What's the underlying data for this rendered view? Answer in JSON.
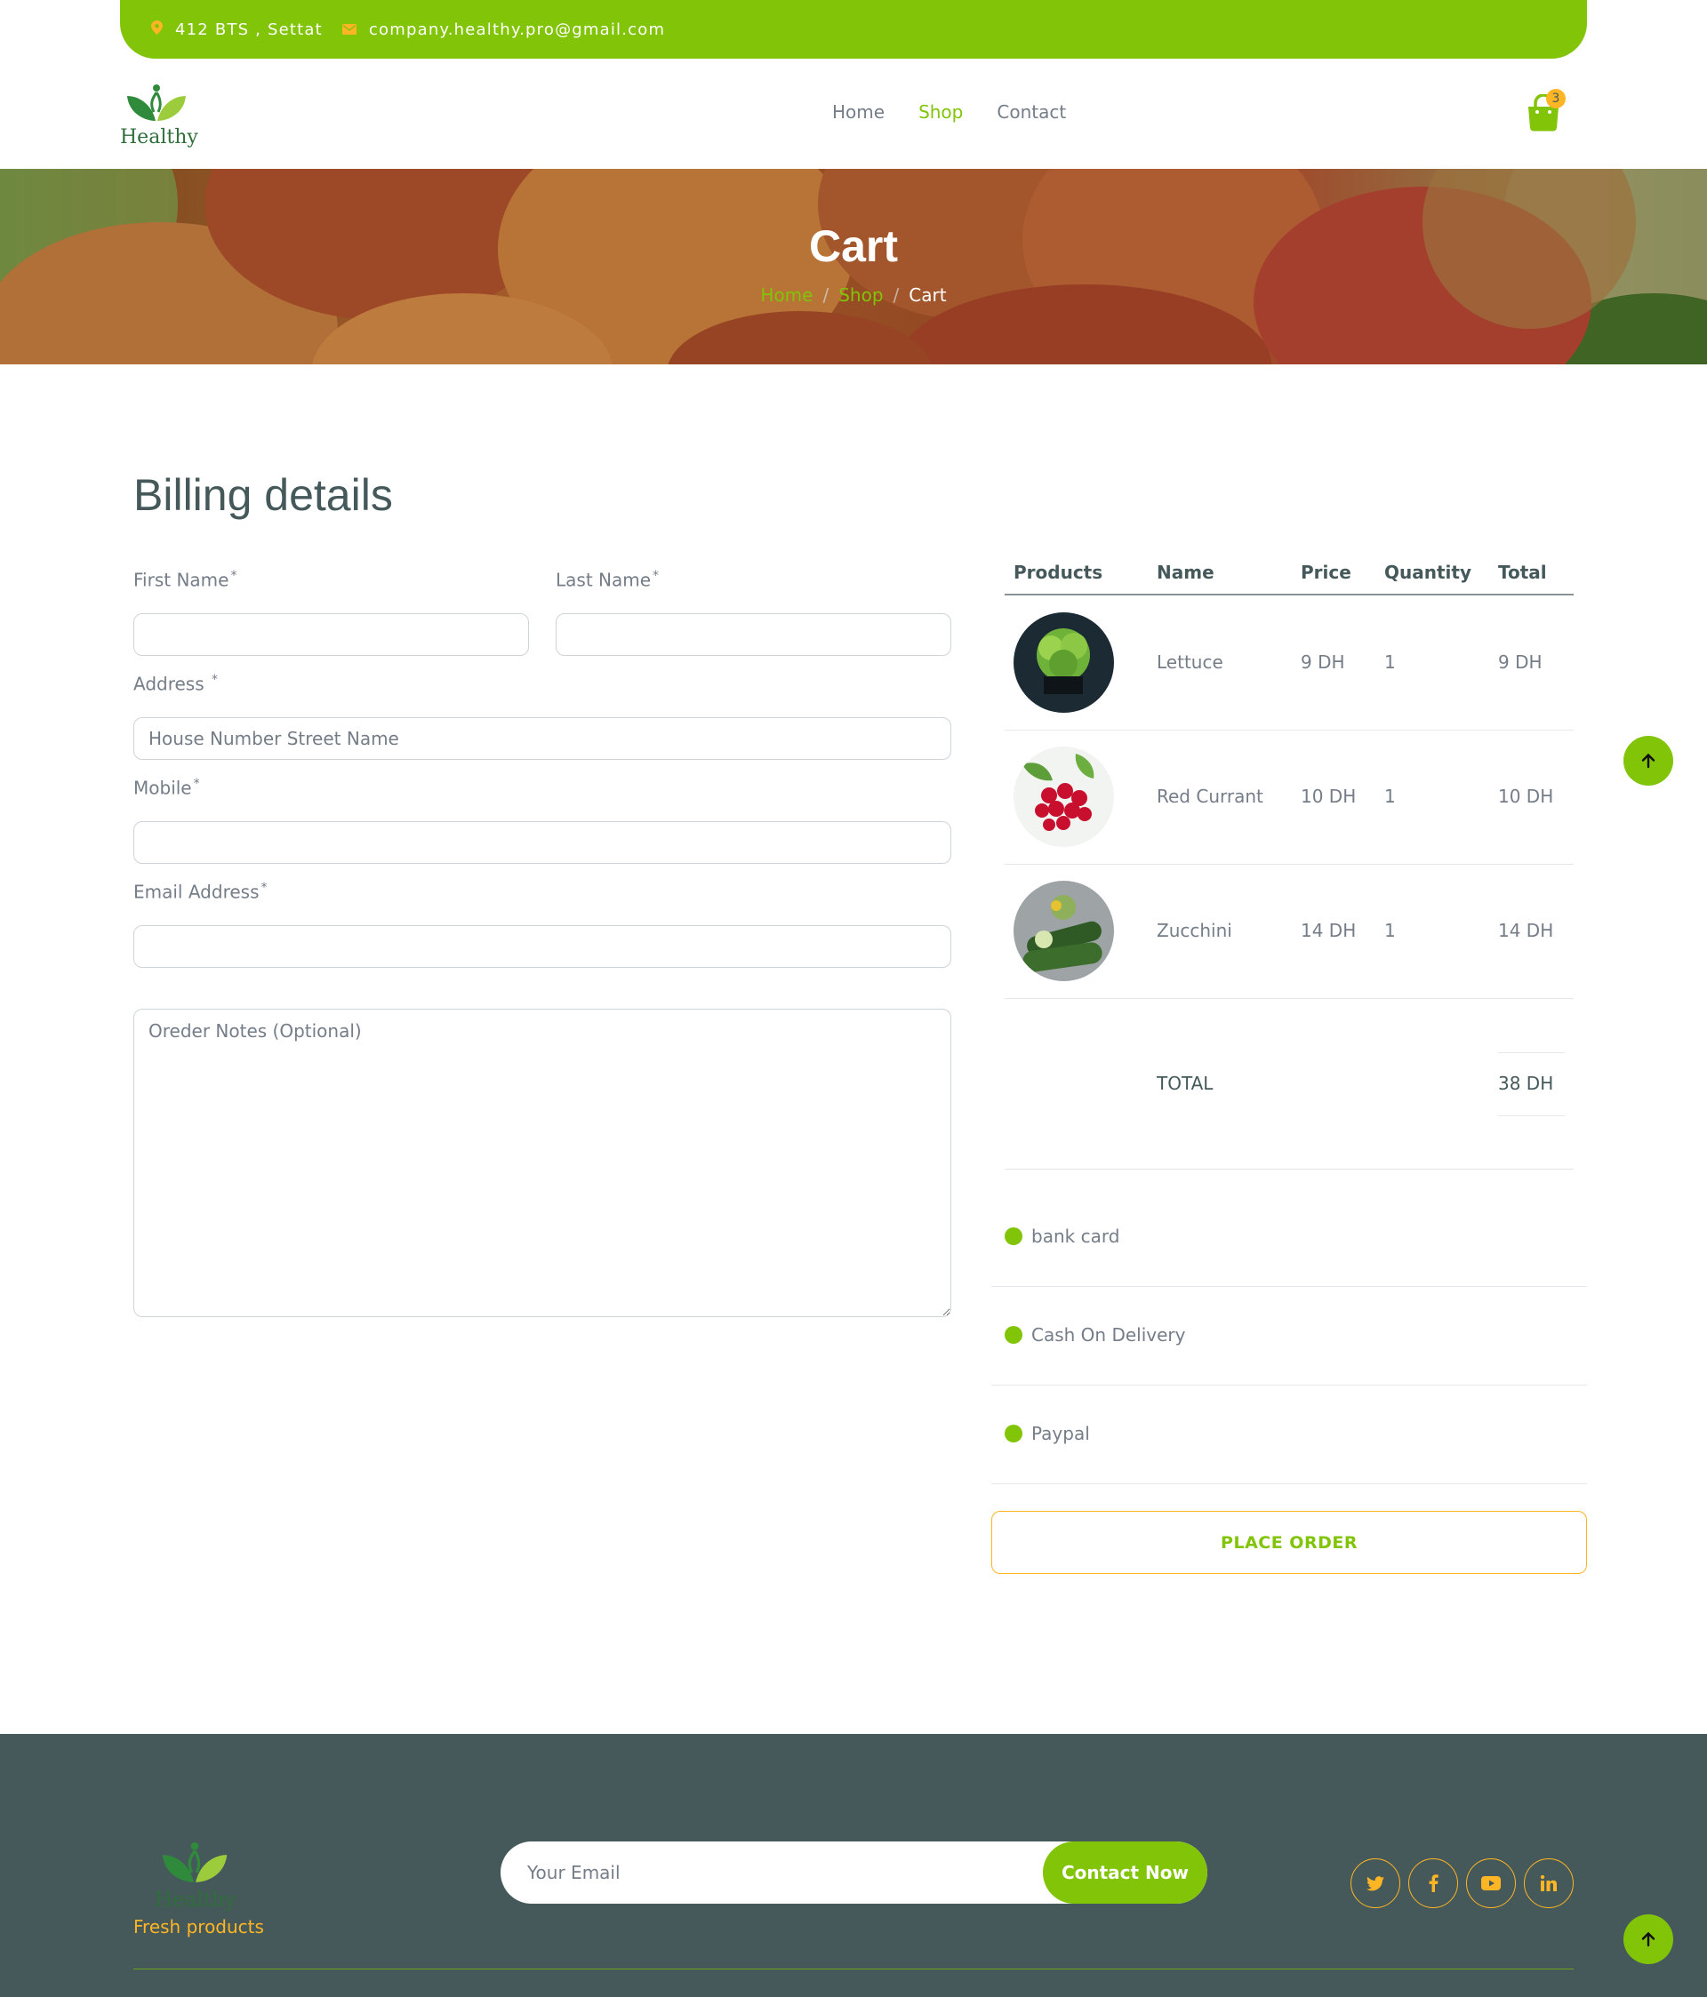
{
  "topbar": {
    "address": "412 BTS , Settat",
    "email": "company.healthy.pro@gmail.com"
  },
  "brand": {
    "name": "Healthy"
  },
  "nav": {
    "items": [
      {
        "label": "Home",
        "active": false
      },
      {
        "label": "Shop",
        "active": true
      },
      {
        "label": "Contact",
        "active": false
      }
    ],
    "cart_count": "3"
  },
  "hero": {
    "title": "Cart",
    "breadcrumb": [
      "Home",
      "Shop",
      "Cart"
    ],
    "separator": "/"
  },
  "billing": {
    "title": "Billing details",
    "first_name": {
      "label": "First Name",
      "value": ""
    },
    "last_name": {
      "label": "Last Name",
      "value": ""
    },
    "address": {
      "label": "Address",
      "placeholder": "House Number Street Name"
    },
    "mobile": {
      "label": "Mobile",
      "value": ""
    },
    "email": {
      "label": "Email Address",
      "value": ""
    },
    "notes": {
      "placeholder": "Oreder Notes (Optional)"
    },
    "required_mark": "*"
  },
  "order": {
    "columns": [
      "Products",
      "Name",
      "Price",
      "Quantity",
      "Total"
    ],
    "rows": [
      {
        "image": "lettuce-image",
        "name": "Lettuce",
        "price": "9 DH",
        "quantity": "1",
        "total": "9 DH"
      },
      {
        "image": "red-currant-image",
        "name": "Red Currant",
        "price": "10 DH",
        "quantity": "1",
        "total": "10 DH"
      },
      {
        "image": "zucchini-image",
        "name": "Zucchini",
        "price": "14 DH",
        "quantity": "1",
        "total": "14 DH"
      }
    ],
    "total_label": "TOTAL",
    "total_value": "38 DH"
  },
  "payment": {
    "options": [
      "bank card",
      "Cash On Delivery",
      "Paypal"
    ],
    "place_order_label": "PLACE ORDER"
  },
  "footer": {
    "tagline": "Fresh products",
    "email_placeholder": "Your Email",
    "cta_label": "Contact Now",
    "social": [
      "twitter-icon",
      "facebook-icon",
      "youtube-icon",
      "linkedin-icon"
    ]
  },
  "colors": {
    "primary": "#81c408",
    "secondary": "#ffb524",
    "dark": "#45595b",
    "text": "#747d88"
  }
}
